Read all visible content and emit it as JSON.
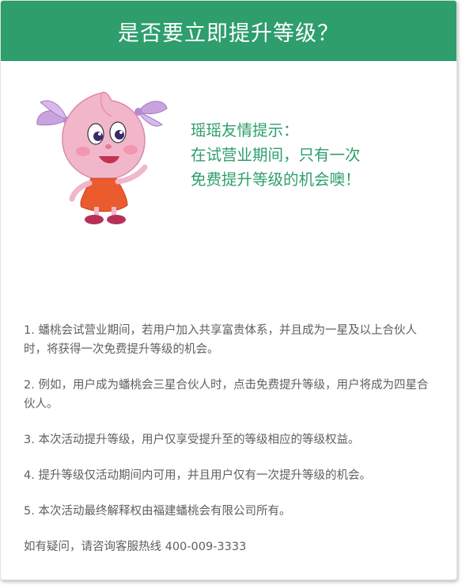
{
  "dialog": {
    "title": "是否要立即提升等级？"
  },
  "tip": {
    "lines": [
      "瑶瑶友情提示：",
      "在试营业期间，只有一次",
      "免费提升等级的机会噢！"
    ]
  },
  "rules": [
    "1. 蟠桃会试营业期间，若用户加入共享富贵体系，并且成为一星及以上合伙人时，将获得一次免费提升等级的机会。",
    "2. 例如，用户成为蟠桃会三星合伙人时，点击免费提升等级，用户将成为四星合伙人。",
    "3. 本次活动提升等级，用户仅享受提升至的等级相应的等级权益。",
    "4. 提升等级仅活动期间内可用，并且用户仅有一次提升等级的机会。",
    "5. 本次活动最终解释权由福建蟠桃会有限公司所有。"
  ],
  "hotline": "如有疑问，请咨询客服热线 400-009-3333",
  "colors": {
    "header": "#2e9e6c",
    "tip_text": "#2e9e6c",
    "body_text": "#5f5f5f"
  },
  "icons": {
    "mascot": "peach-girl-mascot"
  }
}
